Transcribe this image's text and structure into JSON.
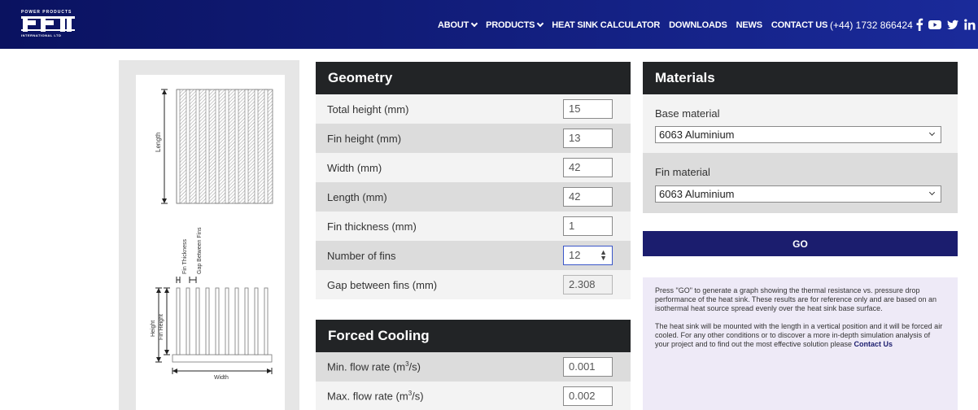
{
  "logo": {
    "top_text": "POWER PRODUCTS",
    "mark": "PPI",
    "bottom_text": "INTERNATIONAL LTD"
  },
  "nav": {
    "items": [
      {
        "label": "ABOUT",
        "dropdown": true
      },
      {
        "label": "PRODUCTS",
        "dropdown": true
      },
      {
        "label": "HEAT SINK CALCULATOR",
        "dropdown": false
      },
      {
        "label": "DOWNLOADS",
        "dropdown": false
      },
      {
        "label": "NEWS",
        "dropdown": false
      },
      {
        "label": "CONTACT US",
        "dropdown": false
      }
    ],
    "phone": "(+44) 1732 866424",
    "social_icons": [
      "facebook-icon",
      "youtube-icon",
      "twitter-icon",
      "linkedin-icon"
    ]
  },
  "diagram": {
    "length_label": "Length",
    "fin_thickness_label": "Fin Thickness",
    "gap_label": "Gap Between Fins",
    "height_label": "Height",
    "fin_height_label": "Fin Height",
    "width_label": "Width"
  },
  "geometry": {
    "title": "Geometry",
    "rows": [
      {
        "label": "Total height (mm)",
        "value": "15"
      },
      {
        "label": "Fin height (mm)",
        "value": "13"
      },
      {
        "label": "Width (mm)",
        "value": "42"
      },
      {
        "label": "Length (mm)",
        "value": "42"
      },
      {
        "label": "Fin thickness (mm)",
        "value": "1"
      },
      {
        "label": "Number of fins",
        "value": "12"
      },
      {
        "label": "Gap between fins (mm)",
        "value": "2.308"
      }
    ]
  },
  "cooling": {
    "title": "Forced Cooling",
    "min_label_pre": "Min. flow rate (m",
    "max_label_pre": "Max. flow rate (m",
    "label_sup": "3",
    "label_post": "/s)",
    "min_value": "0.001",
    "max_value": "0.002"
  },
  "materials": {
    "title": "Materials",
    "base_label": "Base material",
    "base_value": "6063 Aluminium",
    "fin_label": "Fin material",
    "fin_value": "6063 Aluminium"
  },
  "go_button": "GO",
  "info": {
    "para1": "Press \"GO\" to generate a graph showing the thermal resistance vs. pressure drop performance of the heat sink. These results are for reference only and are based on an isothermal heat source spread evenly over the heat sink base surface.",
    "para2": "The heat sink will be mounted with the length in a vertical position and it will be forced air cooled. For any other conditions or to discover a more in-depth simulation analysis of your project and to find out the most effective solution please ",
    "link": "Contact Us"
  },
  "colors": {
    "nav_dark": "#0a1260",
    "nav_light": "#1a2a9a",
    "panel_head": "#222426",
    "go_button": "#1b1d6e",
    "info_bg": "#eeeaf7"
  }
}
